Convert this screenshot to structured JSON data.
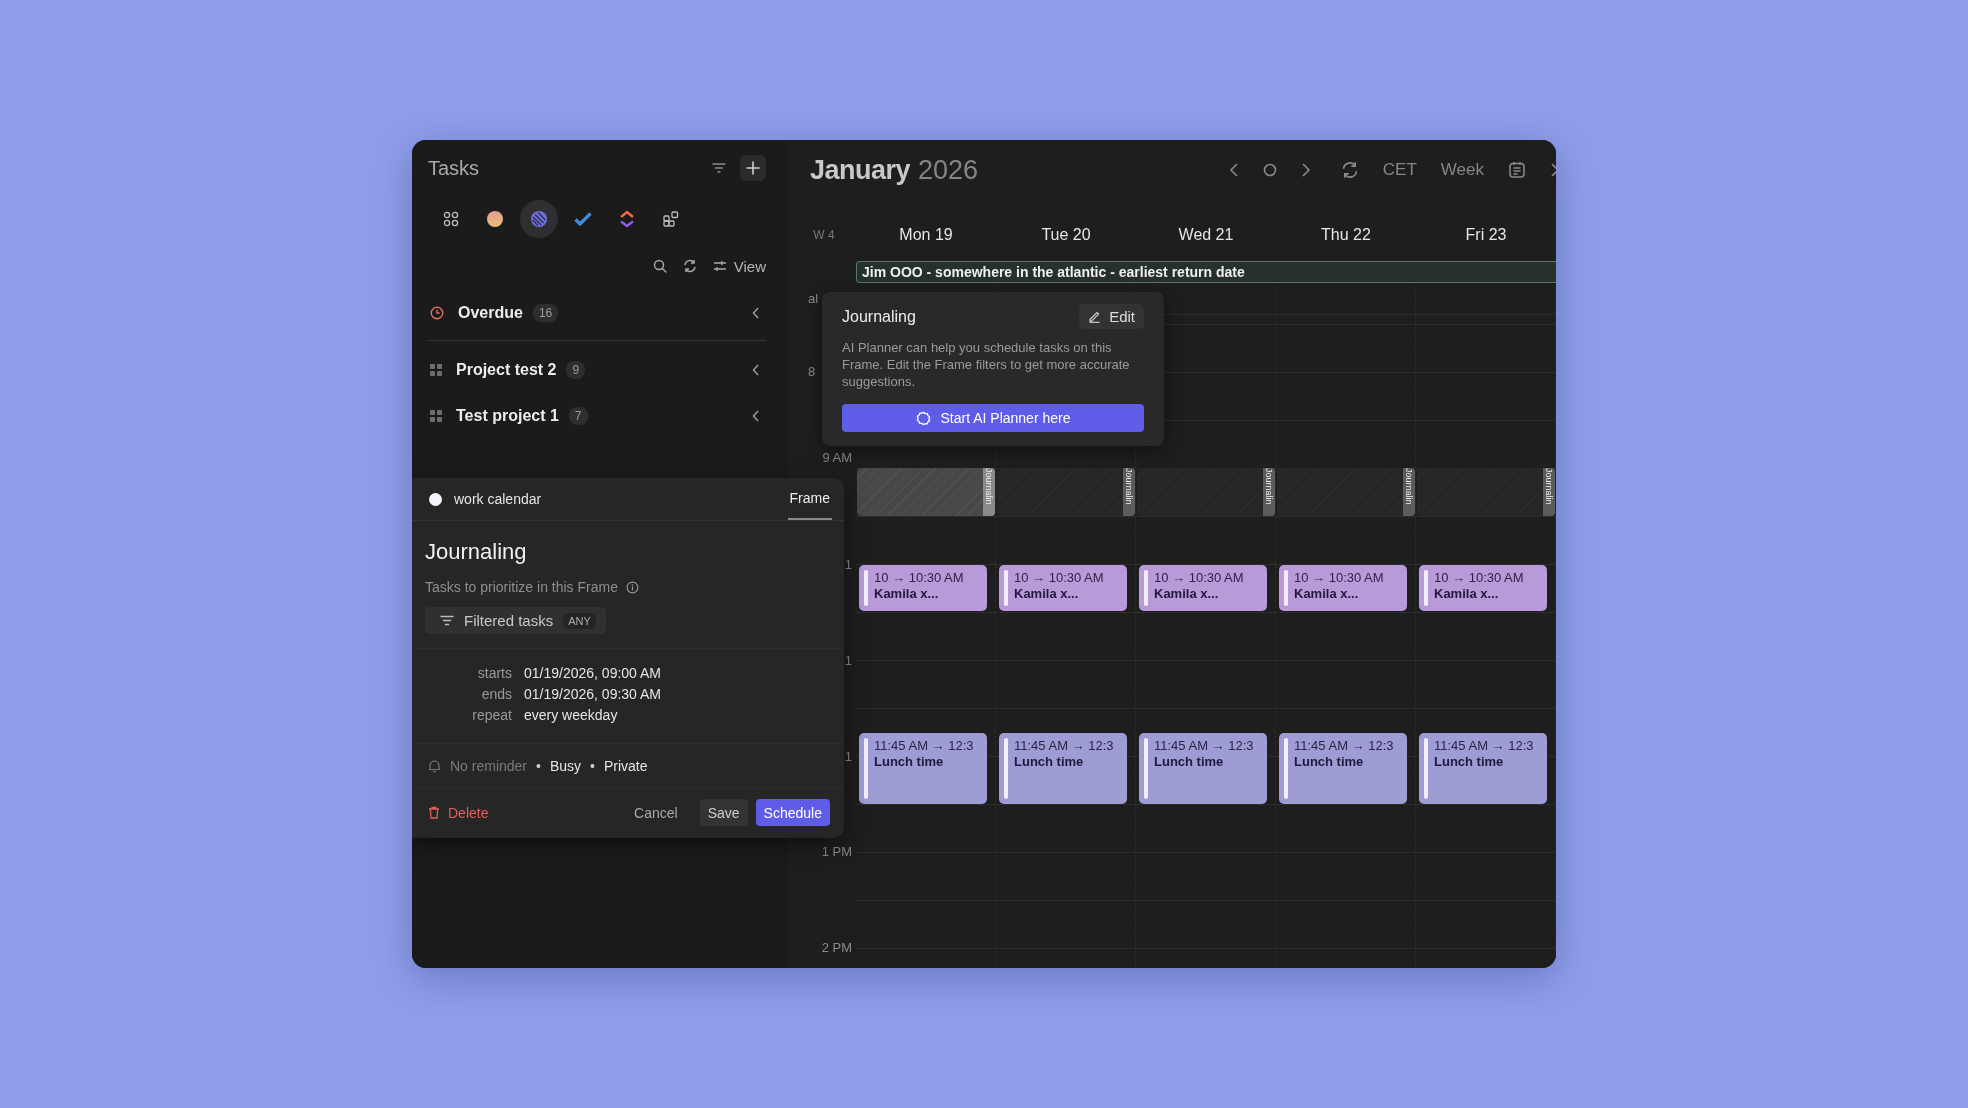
{
  "sidebar": {
    "title": "Tasks",
    "sources": [
      {
        "kind": "grid",
        "selected": false
      },
      {
        "kind": "orb",
        "selected": false
      },
      {
        "kind": "stripes",
        "selected": true
      },
      {
        "kind": "check",
        "selected": false
      },
      {
        "kind": "chevrons",
        "selected": false
      },
      {
        "kind": "blocks",
        "selected": false
      }
    ],
    "view_label": "View",
    "groups": [
      {
        "kind": "overdue",
        "label": "Overdue",
        "count": "16"
      },
      {
        "kind": "project",
        "label": "Project test 2",
        "count": "9"
      },
      {
        "kind": "project",
        "label": "Test project 1",
        "count": "7"
      }
    ]
  },
  "calendar": {
    "month": "January",
    "year": "2026",
    "timezone": "CET",
    "view": "Week",
    "week_label": "W 4",
    "all_day_events": [
      {
        "title": "Jim OOO - somewhere in the atlantic - earliest return date"
      }
    ],
    "time_labels": [
      "al",
      "8",
      "9 AM",
      "1",
      "1",
      "1",
      "1 PM",
      "2 PM"
    ],
    "days": [
      {
        "label": "Mon 19",
        "frame": {
          "label": "Journalin",
          "selected": true
        },
        "events": [
          {
            "kind": "meeting",
            "time": "10 → 10:30 AM",
            "title": "Kamila x..."
          },
          {
            "kind": "lunch",
            "time": "11:45 AM → 12:3",
            "title": "Lunch time"
          }
        ]
      },
      {
        "label": "Tue 20",
        "frame": {
          "label": "Journalin",
          "selected": false
        },
        "events": [
          {
            "kind": "meeting",
            "time": "10 → 10:30 AM",
            "title": "Kamila x..."
          },
          {
            "kind": "lunch",
            "time": "11:45 AM → 12:3",
            "title": "Lunch time"
          }
        ]
      },
      {
        "label": "Wed 21",
        "frame": {
          "label": "Journalin",
          "selected": false
        },
        "events": [
          {
            "kind": "meeting",
            "time": "10 → 10:30 AM",
            "title": "Kamila x..."
          },
          {
            "kind": "lunch",
            "time": "11:45 AM → 12:3",
            "title": "Lunch time"
          }
        ]
      },
      {
        "label": "Thu 22",
        "frame": {
          "label": "Journalin",
          "selected": false
        },
        "events": [
          {
            "kind": "meeting",
            "time": "10 → 10:30 AM",
            "title": "Kamila x..."
          },
          {
            "kind": "lunch",
            "time": "11:45 AM → 12:3",
            "title": "Lunch time"
          }
        ]
      },
      {
        "label": "Fri 23",
        "frame": {
          "label": "Journalin",
          "selected": false
        },
        "events": [
          {
            "kind": "meeting",
            "time": "10 → 10:30 AM",
            "title": "Kamila x..."
          },
          {
            "kind": "lunch",
            "time": "11:45 AM → 12:3",
            "title": "Lunch time"
          }
        ]
      }
    ]
  },
  "frame_popover": {
    "title": "Journaling",
    "edit_label": "Edit",
    "description": "AI Planner can help you schedule tasks on this Frame. Edit the Frame filters to get more accurate suggestions.",
    "action": "Start AI Planner here"
  },
  "event_editor": {
    "calendar": "work calendar",
    "tabs": [
      {
        "label": "Frame",
        "selected": true
      }
    ],
    "title": "Journaling",
    "subtitle": "Tasks to prioritize in this Frame",
    "filter": {
      "label": "Filtered tasks",
      "badge": "ANY"
    },
    "fields": [
      {
        "label": "starts",
        "value": "01/19/2026, 09:00 AM"
      },
      {
        "label": "ends",
        "value": "01/19/2026, 09:30 AM"
      },
      {
        "label": "repeat",
        "value": "every weekday"
      }
    ],
    "meta": [
      {
        "kind": "reminder",
        "text": "No reminder"
      },
      {
        "kind": "separator",
        "text": "•"
      },
      {
        "kind": "value",
        "text": "Busy"
      },
      {
        "kind": "separator",
        "text": "•"
      },
      {
        "kind": "value",
        "text": "Private"
      }
    ],
    "actions": [
      {
        "kind": "delete",
        "label": "Delete"
      },
      {
        "kind": "cancel",
        "label": "Cancel"
      },
      {
        "kind": "save",
        "label": "Save"
      },
      {
        "kind": "primary",
        "label": "Schedule"
      }
    ]
  }
}
